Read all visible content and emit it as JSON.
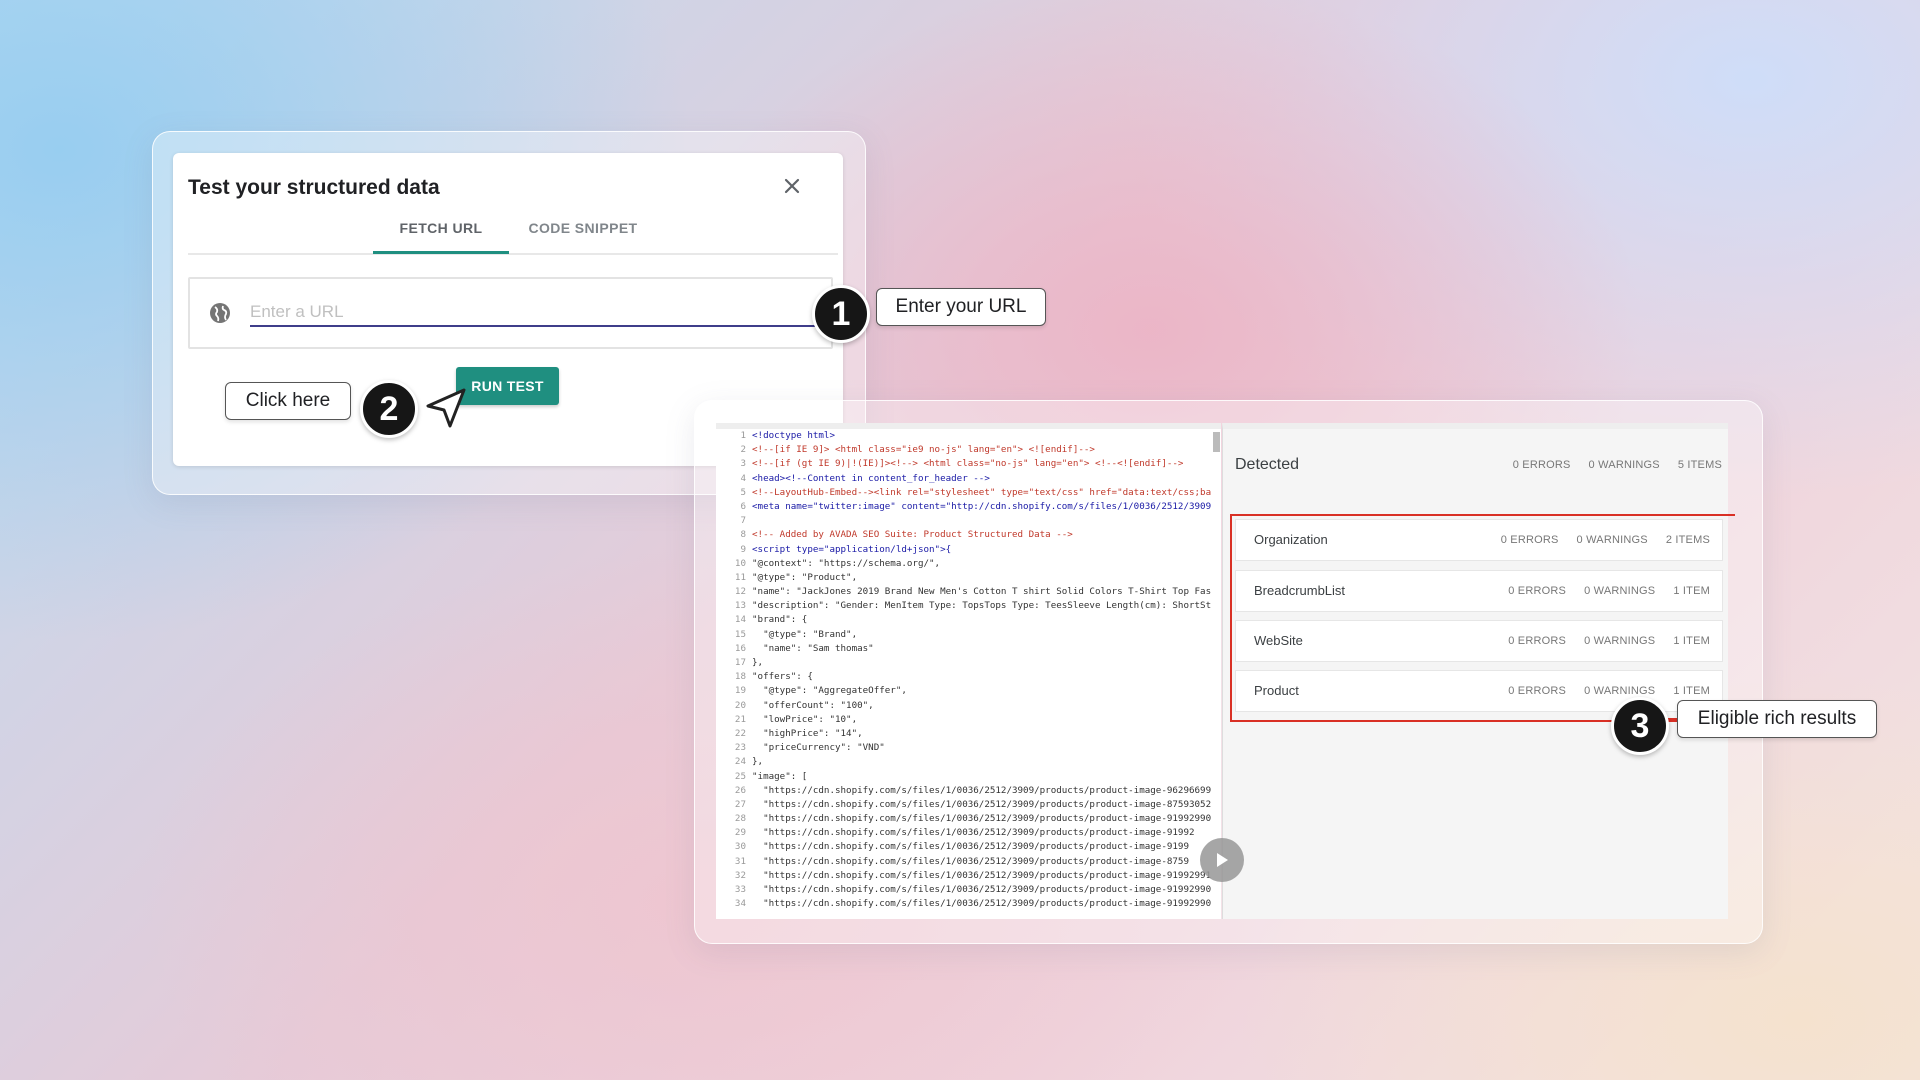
{
  "dialog": {
    "title": "Test your structured data",
    "tabs": [
      "FETCH URL",
      "CODE SNIPPET"
    ],
    "active_tab": "FETCH URL",
    "url_placeholder": "Enter a URL",
    "url_value": "",
    "run_button": "RUN TEST",
    "accent_color": "#1f8f80"
  },
  "callouts": {
    "step1": {
      "number": "1",
      "label": "Enter your URL"
    },
    "step2": {
      "number": "2",
      "label": "Click here"
    },
    "step3": {
      "number": "3",
      "label": "Eligible rich results"
    }
  },
  "code": {
    "lines": [
      {
        "n": "1",
        "text": "<!doctype html>"
      },
      {
        "n": "2",
        "text": "<!--[if IE 9]> <html class=\"ie9 no-js\" lang=\"en\"> <![endif]-->"
      },
      {
        "n": "3",
        "text": "<!--[if (gt IE 9)|!(IE)]><!--> <html class=\"no-js\" lang=\"en\"> <!--<![endif]-->"
      },
      {
        "n": "4",
        "text": "<head><!--Content in content_for_header -->"
      },
      {
        "n": "5",
        "text": "<!--LayoutHub-Embed--><link rel=\"stylesheet\" type=\"text/css\" href=\"data:text/css;ba"
      },
      {
        "n": "6",
        "text": "<meta name=\"twitter:image\" content=\"http://cdn.shopify.com/s/files/1/0036/2512/3909"
      },
      {
        "n": "7",
        "text": ""
      },
      {
        "n": "8",
        "text": "<!-- Added by AVADA SEO Suite: Product Structured Data -->"
      },
      {
        "n": "9",
        "text": "<script type=\"application/ld+json\">{"
      },
      {
        "n": "10",
        "text": "\"@context\": \"https://schema.org/\","
      },
      {
        "n": "11",
        "text": "\"@type\": \"Product\","
      },
      {
        "n": "12",
        "text": "\"name\": \"JackJones 2019 Brand New Men's Cotton T shirt Solid Colors T-Shirt Top Fas"
      },
      {
        "n": "13",
        "text": "\"description\": \"Gender: MenItem Type: TopsTops Type: TeesSleeve Length(cm): ShortSt"
      },
      {
        "n": "14",
        "text": "\"brand\": {"
      },
      {
        "n": "15",
        "text": "  \"@type\": \"Brand\","
      },
      {
        "n": "16",
        "text": "  \"name\": \"Sam thomas\""
      },
      {
        "n": "17",
        "text": "},"
      },
      {
        "n": "18",
        "text": "\"offers\": {"
      },
      {
        "n": "19",
        "text": "  \"@type\": \"AggregateOffer\","
      },
      {
        "n": "20",
        "text": "  \"offerCount\": \"100\","
      },
      {
        "n": "21",
        "text": "  \"lowPrice\": \"10\","
      },
      {
        "n": "22",
        "text": "  \"highPrice\": \"14\","
      },
      {
        "n": "23",
        "text": "  \"priceCurrency\": \"VND\""
      },
      {
        "n": "24",
        "text": "},"
      },
      {
        "n": "25",
        "text": "\"image\": ["
      },
      {
        "n": "26",
        "text": "  \"https://cdn.shopify.com/s/files/1/0036/2512/3909/products/product-image-96296699"
      },
      {
        "n": "27",
        "text": "  \"https://cdn.shopify.com/s/files/1/0036/2512/3909/products/product-image-87593052"
      },
      {
        "n": "28",
        "text": "  \"https://cdn.shopify.com/s/files/1/0036/2512/3909/products/product-image-91992990"
      },
      {
        "n": "29",
        "text": "  \"https://cdn.shopify.com/s/files/1/0036/2512/3909/products/product-image-91992"
      },
      {
        "n": "30",
        "text": "  \"https://cdn.shopify.com/s/files/1/0036/2512/3909/products/product-image-9199"
      },
      {
        "n": "31",
        "text": "  \"https://cdn.shopify.com/s/files/1/0036/2512/3909/products/product-image-8759"
      },
      {
        "n": "32",
        "text": "  \"https://cdn.shopify.com/s/files/1/0036/2512/3909/products/product-image-91992991"
      },
      {
        "n": "33",
        "text": "  \"https://cdn.shopify.com/s/files/1/0036/2512/3909/products/product-image-91992990"
      },
      {
        "n": "34",
        "text": "  \"https://cdn.shopify.com/s/files/1/0036/2512/3909/products/product-image-91992990"
      }
    ]
  },
  "detected": {
    "title": "Detected",
    "errors": "0 ERRORS",
    "warnings": "0 WARNINGS",
    "items": "5 ITEMS",
    "highlight_color": "#d93025",
    "rows": [
      {
        "name": "Organization",
        "errors": "0 ERRORS",
        "warnings": "0 WARNINGS",
        "items": "2 ITEMS"
      },
      {
        "name": "BreadcrumbList",
        "errors": "0 ERRORS",
        "warnings": "0 WARNINGS",
        "items": "1 ITEM"
      },
      {
        "name": "WebSite",
        "errors": "0 ERRORS",
        "warnings": "0 WARNINGS",
        "items": "1 ITEM"
      },
      {
        "name": "Product",
        "errors": "0 ERRORS",
        "warnings": "0 WARNINGS",
        "items": "1 ITEM"
      }
    ]
  },
  "icons": {
    "close": "close-icon",
    "globe": "globe-icon",
    "cursor": "cursor-arrow-icon",
    "play": "play-icon"
  }
}
